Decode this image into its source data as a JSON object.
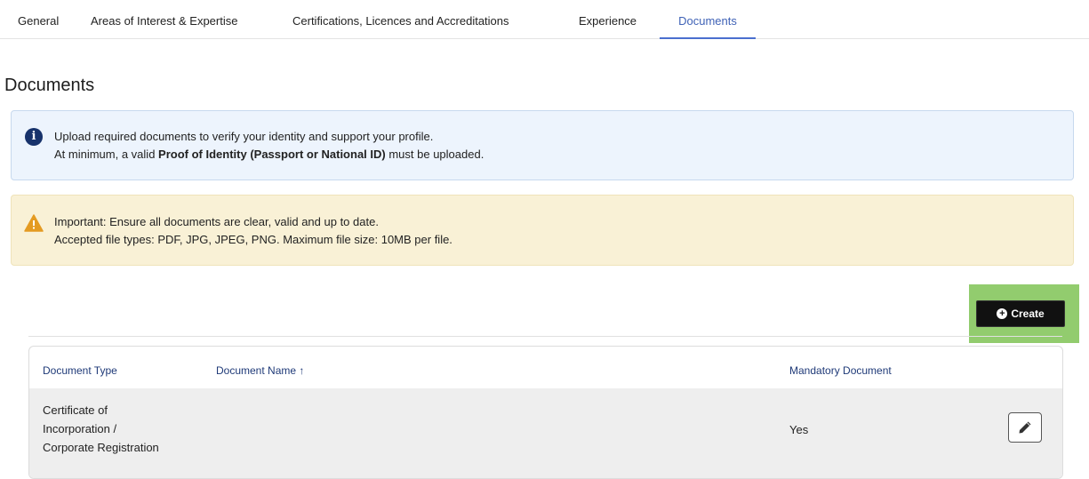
{
  "tabs": [
    {
      "label": "General",
      "active": false
    },
    {
      "label": "Areas of Interest & Expertise",
      "active": false
    },
    {
      "label": "Certifications, Licences and Accreditations",
      "active": false
    },
    {
      "label": "Experience",
      "active": false
    },
    {
      "label": "Documents",
      "active": true
    }
  ],
  "page": {
    "title": "Documents"
  },
  "info_alert": {
    "line1": "Upload required documents to verify your identity and support your profile.",
    "line2_prefix": "At minimum, a valid ",
    "line2_bold": "Proof of Identity (Passport or National ID)",
    "line2_suffix": " must be uploaded.",
    "icon": "info-icon"
  },
  "warning_alert": {
    "line1": "Important: Ensure all documents are clear, valid and up to date.",
    "line2": "Accepted file types: PDF, JPG, JPEG, PNG. Maximum file size: 10MB per file.",
    "icon": "warning-icon"
  },
  "toolbar": {
    "create_label": "Create",
    "highlight_color": "#92cc6e"
  },
  "table": {
    "columns": {
      "document_type": "Document Type",
      "document_name": "Document Name",
      "sort_arrow": "↑",
      "mandatory": "Mandatory Document"
    },
    "rows": [
      {
        "document_type": [
          "Certificate of",
          "Incorporation /",
          "Corporate Registration"
        ],
        "document_name": "",
        "mandatory": "Yes"
      }
    ]
  },
  "colors": {
    "accent": "#3f62b6",
    "header_text": "#1f3a78",
    "info_bg": "#edf4fd",
    "warn_bg": "#f9f1d6"
  }
}
